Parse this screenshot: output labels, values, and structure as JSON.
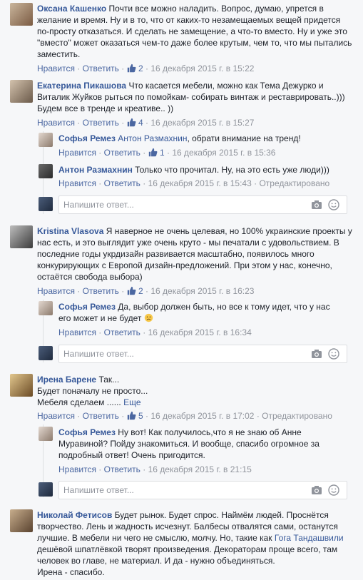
{
  "ui": {
    "like": "Нравится",
    "reply": "Ответить",
    "edited": "Отредактировано",
    "reply_placeholder": "Напишите ответ...",
    "more": "Еще"
  },
  "comments": [
    {
      "author": "Оксана Кашенко",
      "text": "Почти все можно наладить. Вопрос, думаю, упрется в желание и время. Ну и в то, что от каких-то незамещаемых вещей придется по-просту отказаться. И сделать не замещение, а что-то вместо. Ну и уже это \"вместо\" может оказаться чем-то даже более крутым, чем то, что мы пытались заместить.",
      "likes": "2",
      "time": "16 декабря 2015 г. в 15:22"
    },
    {
      "author": "Екатерина Пикашова",
      "text": "Что касается мебели, можно как Тема Дежурко и Виталик Жуйков рыться по помойкам- собирать винтаж и реставрировать..))) Будем все в тренде и креативе.. ))",
      "likes": "4",
      "time": "16 декабря 2015 г. в 15:27",
      "replies": [
        {
          "author": "Софья Ремез",
          "mention": "Антон Размахнин",
          "text": ", обрати внимание на тренд!",
          "likes": "1",
          "time": "16 декабря 2015 г. в 15:36"
        },
        {
          "author": "Антон Размахнин",
          "text": "Только что прочитал. Ну, на это есть уже люди)))",
          "time": "16 декабря 2015 г. в 15:43"
        }
      ]
    },
    {
      "author": "Kristina Vlasova",
      "text": "Я наверное не очень целевая, но 100% украинские проекты у нас есть, и это выглядит уже очень круто - мы печатали с удовольствием. В последние годы укрдизайн развивается масштабно, появилось много конкурирующих с Европой дизайн-предложений. При этом у нас, конечно, остаётся свобода выбора)",
      "likes": "2",
      "time": "16 декабря 2015 г. в 16:23",
      "replies": [
        {
          "author": "Софья Ремез",
          "text": "Да, выбор должен быть, но все к тому идет, что у нас его может и не будет",
          "time": "16 декабря 2015 г. в 16:34"
        }
      ]
    },
    {
      "author": "Ирена Барене",
      "text1": "Так...",
      "text2": "Будет поначалу не просто...",
      "text3": "Мебеля сделаем ......",
      "likes": "5",
      "time": "16 декабря 2015 г. в 17:02",
      "replies": [
        {
          "author": "Софья Ремез",
          "text": "Ну вот! Как получилось,что я не знаю об Анне Муравиной? Пойду знакомиться. И вообще, спасибо огромное за подробный ответ! Очень пригодится.",
          "time": "16 декабря 2015 г. в 21:15"
        }
      ]
    },
    {
      "author": "Николай Фетисов",
      "text_a": "Будет рынок. Будет спрос. Наймём людей. Проснётся творчество. Лень и жадность исчезнут. Балбесы отвалятся сами, останутся лучшие. В мебели ни чего не смыслю, молчу. Но, такие как",
      "mention": "Гога Тандашвили",
      "text_b": "дешёвой шпатлёвкой творят произведения. Декораторам проще всего, там человек во главе, не материал. И да - нужно объединяться.",
      "text_c": "Ирена - спасибо."
    }
  ],
  "colors": {
    "link": "#365899",
    "meta": "#90949c",
    "background": "#f6f7f9",
    "border": "#dddfe2"
  }
}
